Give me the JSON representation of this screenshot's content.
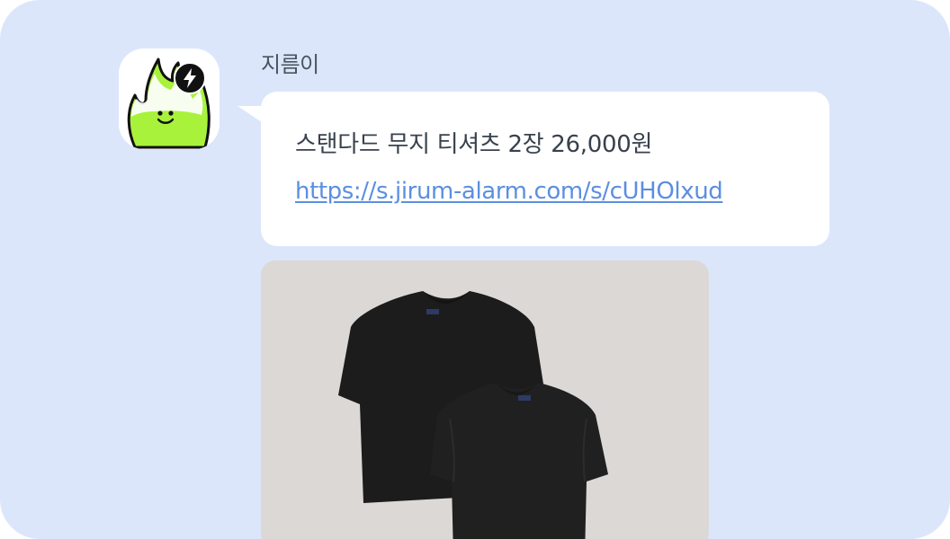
{
  "sender": {
    "name": "지름이",
    "avatar_icon": "fire-mascot-icon",
    "badge_icon": "lightning-bolt-icon",
    "mascot_color": "#a9f23c"
  },
  "message": {
    "text": "스탠다드 무지 티셔츠 2장 26,000원",
    "link": "https://s.jirum-alarm.com/s/cUHOlxud",
    "link_color": "#5b8fe0"
  },
  "product": {
    "image_subject": "two black t-shirts",
    "shirt_color": "#1c1c1d",
    "background_color": "#dbd8d6"
  },
  "theme": {
    "background": "#dce6fb",
    "bubble": "#ffffff"
  }
}
